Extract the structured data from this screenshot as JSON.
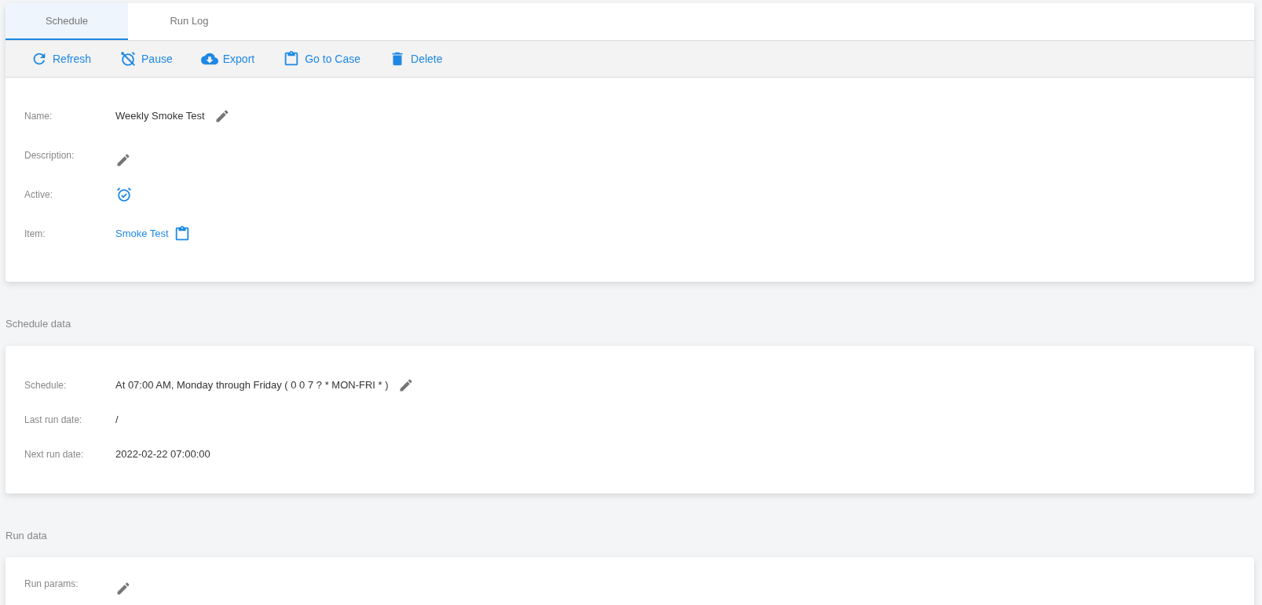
{
  "tabs": [
    {
      "label": "Schedule",
      "selected": true
    },
    {
      "label": "Run Log",
      "selected": false
    }
  ],
  "toolbar": [
    {
      "label": "Refresh"
    },
    {
      "label": "Pause"
    },
    {
      "label": "Export"
    },
    {
      "label": "Go to Case"
    },
    {
      "label": "Delete"
    }
  ],
  "sections": [
    {
      "fields": [
        {
          "label": "Name:",
          "kind": "text",
          "value": "Weekly Smoke Test",
          "editable": true
        },
        {
          "label": "Description:",
          "kind": "text",
          "editable": true
        },
        {
          "label": "Active:",
          "kind": "status",
          "active": true
        },
        {
          "label": "Item:",
          "kind": "link",
          "value": "Smoke Test"
        }
      ]
    },
    {
      "title": "Schedule data",
      "fields": [
        {
          "label": "Schedule:",
          "kind": "text",
          "value": "At 07:00 AM, Monday through Friday ( 0 0 7 ? * MON-FRI * )",
          "editable": true
        },
        {
          "label": "Last run date:",
          "kind": "text",
          "value": "/",
          "editable": false
        },
        {
          "label": "Next run date:",
          "kind": "text",
          "value": "2022-02-22 07:00:00",
          "editable": false
        }
      ]
    },
    {
      "title": "Run data",
      "fields": [
        {
          "label": "Run params:",
          "kind": "text",
          "editable": true
        }
      ]
    }
  ]
}
